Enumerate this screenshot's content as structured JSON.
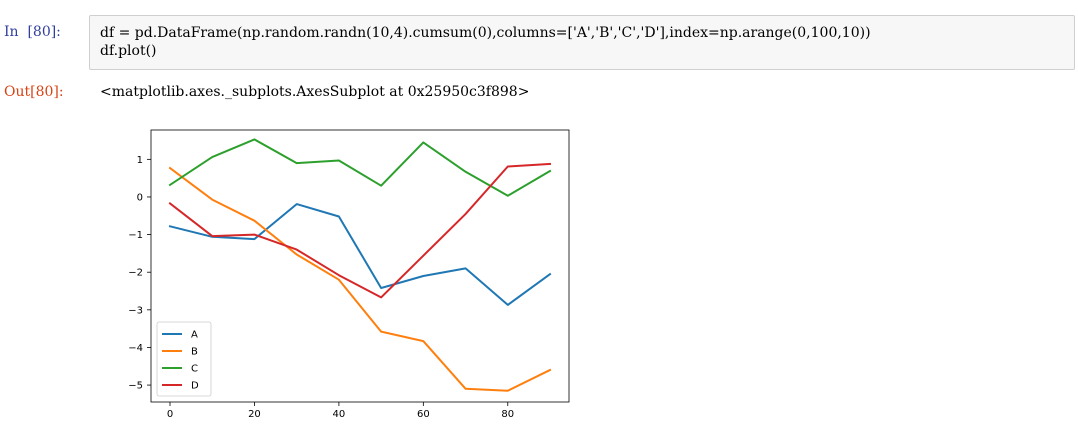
{
  "cell": {
    "in_prompt": "In  [80]:",
    "code_lines": [
      "df = pd.DataFrame(np.random.randn(10,4).cumsum(0),columns=['A','B','C','D'],index=np.arange(0,100,10))",
      "df.plot()"
    ],
    "out_prompt": "Out[80]:",
    "output_text": "<matplotlib.axes._subplots.AxesSubplot at 0x25950c3f898>"
  },
  "chart_data": {
    "type": "line",
    "x": [
      0,
      10,
      20,
      30,
      40,
      50,
      60,
      70,
      80,
      90
    ],
    "xlim": [
      -4.5,
      94.5
    ],
    "ylim": [
      -5.45,
      1.78
    ],
    "xticks": [
      0,
      20,
      40,
      60,
      80
    ],
    "xtick_labels": [
      "0",
      "20",
      "40",
      "60",
      "80"
    ],
    "yticks": [
      1,
      0,
      -1,
      -2,
      -3,
      -4,
      -5
    ],
    "ytick_labels": [
      "1",
      "0",
      "−1",
      "−2",
      "−3",
      "−4",
      "−5"
    ],
    "grid": false,
    "legend_position": "lower-left",
    "series": [
      {
        "name": "A",
        "color": "#1f77b4",
        "values": [
          -0.78,
          -1.06,
          -1.12,
          -0.19,
          -0.52,
          -2.42,
          -2.1,
          -1.9,
          -2.87,
          -2.05
        ]
      },
      {
        "name": "B",
        "color": "#ff7f0e",
        "values": [
          0.77,
          -0.07,
          -0.63,
          -1.53,
          -2.2,
          -3.58,
          -3.83,
          -5.1,
          -5.15,
          -4.6
        ]
      },
      {
        "name": "C",
        "color": "#2ca02c",
        "values": [
          0.32,
          1.06,
          1.53,
          0.9,
          0.97,
          0.3,
          1.45,
          0.67,
          0.03,
          0.69
        ]
      },
      {
        "name": "D",
        "color": "#d62728",
        "values": [
          -0.17,
          -1.04,
          -1.0,
          -1.4,
          -2.08,
          -2.67,
          -1.56,
          -0.45,
          0.81,
          0.88
        ]
      }
    ]
  }
}
